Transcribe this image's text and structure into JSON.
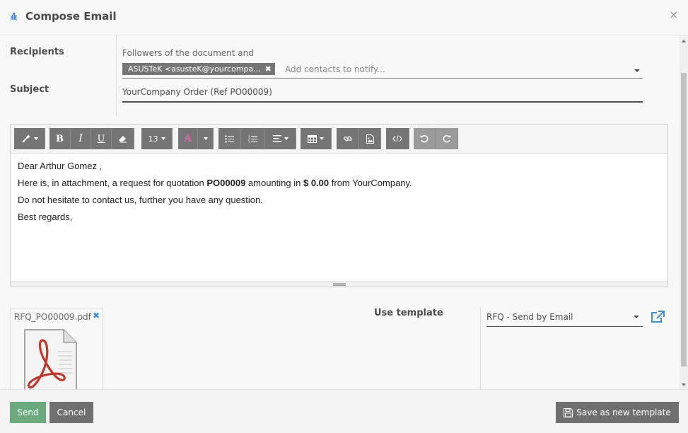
{
  "dialog": {
    "title": "Compose Email",
    "close": "×"
  },
  "recipients": {
    "label": "Recipients",
    "followers_text": "Followers of the document and",
    "tag": "ASUSTeK <asusteK@yourcompa...",
    "tag_remove": "✖",
    "placeholder": "Add contacts to notify..."
  },
  "subject": {
    "label": "Subject",
    "value": "YourCompany Order (Ref PO00009)"
  },
  "toolbar": {
    "font_size": "13"
  },
  "body": {
    "greeting": "Dear Arthur Gomez ,",
    "line2_a": "Here is, in attachment, a request for quotation ",
    "line2_po": "PO00009",
    "line2_b": " amounting in ",
    "line2_amount": "$ 0.00",
    "line2_c": " from YourCompany.",
    "line3": "Do not hesitate to contact us, further you have any question.",
    "line4": "Best regards,"
  },
  "attachment": {
    "filename": "RFQ_PO00009.pdf",
    "remove": "✖"
  },
  "template": {
    "label": "Use template",
    "value": "RFQ - Send by Email"
  },
  "footer": {
    "send": "Send",
    "cancel": "Cancel",
    "save_template": "Save as new template"
  },
  "colors": {
    "send": "#6aab7d",
    "button_dark": "#6f6f6f",
    "link_blue": "#3d8fd9"
  }
}
